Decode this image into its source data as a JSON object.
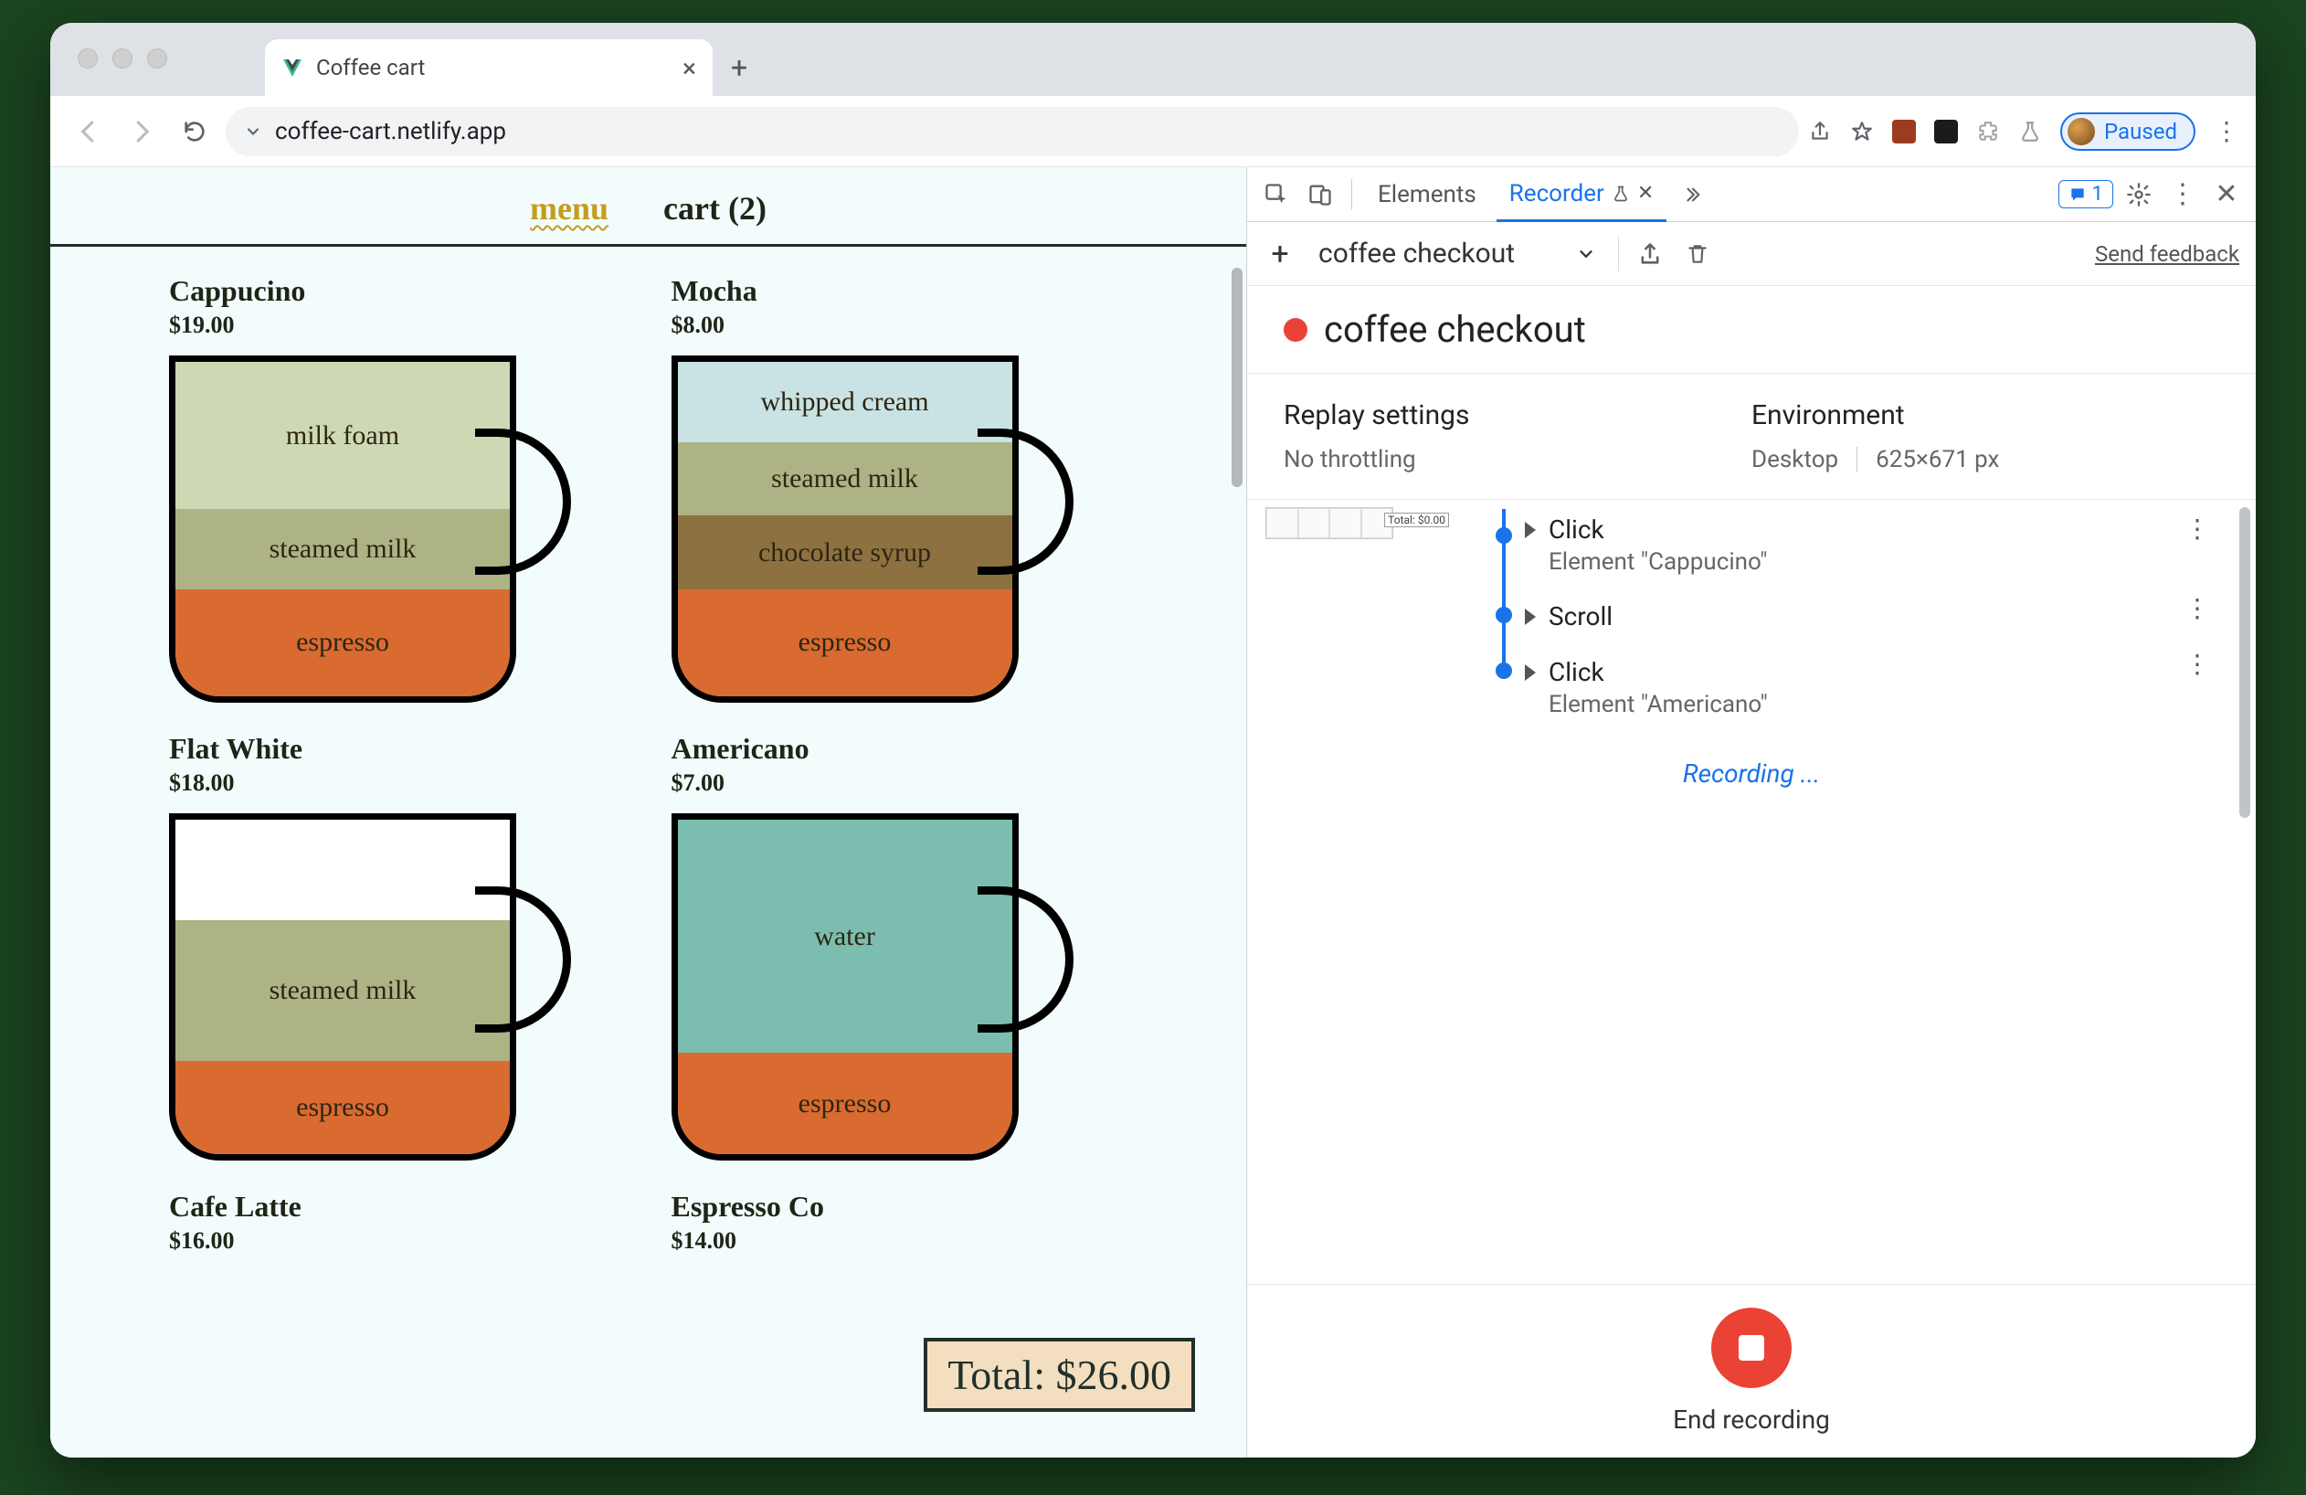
{
  "browser": {
    "tab_title": "Coffee cart",
    "url": "coffee-cart.netlify.app",
    "paused_label": "Paused"
  },
  "page": {
    "nav": {
      "menu": "menu",
      "cart": "cart (2)"
    },
    "items": [
      {
        "name": "Cappucino",
        "price": "$19.00",
        "layers": [
          {
            "label": "milk foam",
            "color": "#cdd9b4",
            "flex": 2.2
          },
          {
            "label": "steamed milk",
            "color": "#aeb385",
            "flex": 1.2
          },
          {
            "label": "espresso",
            "color": "#d96a30",
            "flex": 1.6
          }
        ]
      },
      {
        "name": "Mocha",
        "price": "$8.00",
        "layers": [
          {
            "label": "whipped cream",
            "color": "#c9e2e3",
            "flex": 1.2
          },
          {
            "label": "steamed milk",
            "color": "#aeb385",
            "flex": 1.1
          },
          {
            "label": "chocolate syrup",
            "color": "#8d7140",
            "flex": 1.1
          },
          {
            "label": "espresso",
            "color": "#d96a30",
            "flex": 1.6
          }
        ]
      },
      {
        "name": "Flat White",
        "price": "$18.00",
        "layers": [
          {
            "label": "",
            "color": "#ffffff",
            "flex": 1.5
          },
          {
            "label": "steamed milk",
            "color": "#aeb385",
            "flex": 2.1
          },
          {
            "label": "espresso",
            "color": "#d96a30",
            "flex": 1.4
          }
        ]
      },
      {
        "name": "Americano",
        "price": "$7.00",
        "layers": [
          {
            "label": "water",
            "color": "#7bbdae",
            "flex": 3
          },
          {
            "label": "espresso",
            "color": "#d96a30",
            "flex": 1.3
          }
        ]
      },
      {
        "name": "Cafe Latte",
        "price": "$16.00",
        "layers": []
      },
      {
        "name": "Espresso Co",
        "price": "$14.00",
        "layers": []
      }
    ],
    "total": "Total: $26.00"
  },
  "devtools": {
    "tabs": {
      "elements": "Elements",
      "recorder": "Recorder"
    },
    "msg_count": "1",
    "feedback": "Send feedback",
    "recording_name": "coffee checkout",
    "title": "coffee checkout",
    "settings": {
      "replay_h": "Replay settings",
      "replay_v": "No throttling",
      "env_h": "Environment",
      "env_device": "Desktop",
      "env_dims": "625×671 px"
    },
    "steps": [
      {
        "type": "Click",
        "desc": "Element \"Cappucino\"",
        "partial": true
      },
      {
        "type": "Scroll",
        "desc": ""
      },
      {
        "type": "Click",
        "desc": "Element \"Americano\""
      }
    ],
    "recording_label": "Recording ...",
    "end_label": "End recording"
  }
}
